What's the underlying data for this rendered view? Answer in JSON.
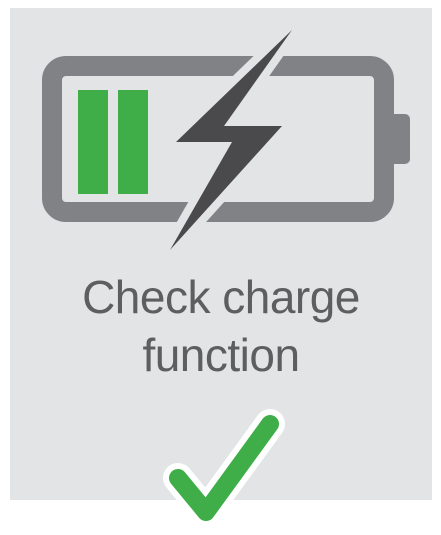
{
  "tile": {
    "label_line1": "Check charge",
    "label_line2": "function",
    "battery_icon": "battery-charging-icon",
    "bolt_icon": "lightning-bolt-icon",
    "check_icon": "checkmark-icon",
    "charge_level": 0.4,
    "colors": {
      "background": "#e3e4e6",
      "battery_outline": "#808285",
      "charge_bars": "#3fae49",
      "bolt": "#4a4a4c",
      "text": "#5d5e60",
      "check": "#3fae49",
      "check_outline": "#ffffff"
    }
  }
}
